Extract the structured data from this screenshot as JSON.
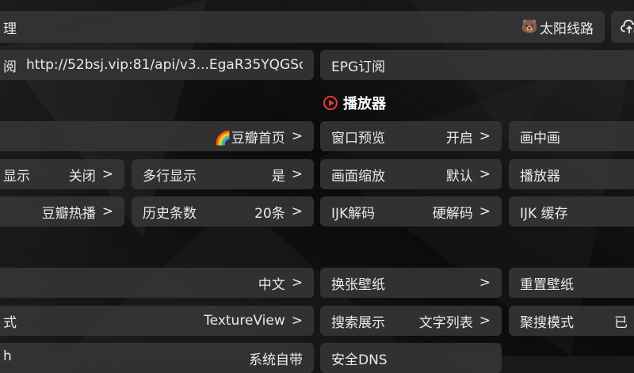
{
  "header": {
    "config_title": "理",
    "source_name": "太阳线路",
    "source_icon": "🐻",
    "upload_icon": "cloud-upload-icon"
  },
  "subscription": {
    "label": "阅",
    "url": "http://52bsj.vip:81/api/v3...EgaR35YQGSo%",
    "epg_label": "EPG订阅"
  },
  "section": {
    "title": "播放器"
  },
  "rows": {
    "r1": {
      "home_value": "🌈豆瓣首页",
      "window_preview_label": "窗口预览",
      "window_preview_value": "开启",
      "pip_label": "画中画"
    },
    "r2": {
      "display_label": "显示",
      "display_value": "关闭",
      "multiline_label": "多行显示",
      "multiline_value": "是",
      "scale_label": "画面缩放",
      "scale_value": "默认",
      "player_label": "播放器"
    },
    "r3": {
      "hot_value": "豆瓣热播",
      "history_label": "历史条数",
      "history_value": "20条",
      "ijk_decode_label": "IJK解码",
      "ijk_decode_value": "硬解码",
      "ijk_cache_label": "IJK 缓存"
    },
    "r4": {
      "language_value": "中文",
      "wallpaper_label": "换张壁纸",
      "reset_wallpaper_label": "重置壁纸"
    },
    "r5": {
      "render_label": "式",
      "render_value": "TextureView",
      "search_display_label": "搜索展示",
      "search_display_value": "文字列表",
      "aggregate_label": "聚搜模式",
      "aggregate_value": "已"
    },
    "r6": {
      "partial_label": "h",
      "partial_value": "系统自带",
      "dns_label": "安全DNS"
    }
  },
  "arrow": ">"
}
